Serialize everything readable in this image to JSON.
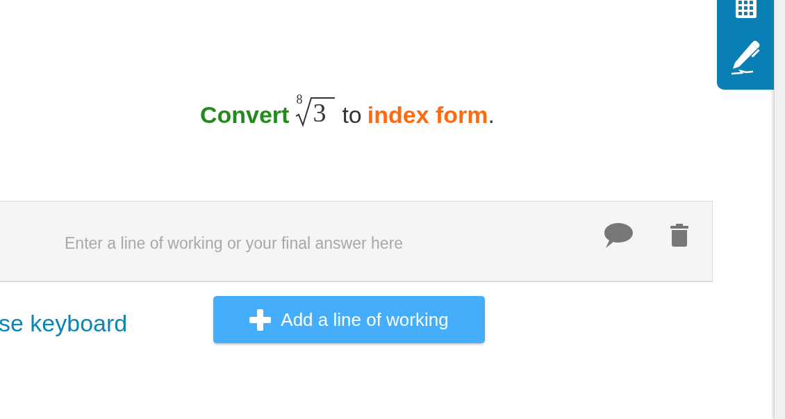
{
  "tools": {
    "items": [
      {
        "kind": "calculator"
      },
      {
        "kind": "pen"
      }
    ]
  },
  "question": {
    "parts": [
      {
        "kind": "emphasis",
        "text": "Convert",
        "color": "#238a1e"
      },
      {
        "kind": "root",
        "index": "8",
        "radicand": "3"
      },
      {
        "kind": "plain",
        "text": "to"
      },
      {
        "kind": "emphasis",
        "text": "index form",
        "color": "#ff6a10"
      },
      {
        "kind": "punct",
        "text": "."
      }
    ]
  },
  "answer": {
    "placeholder": "Enter a line of working or your final answer here"
  },
  "keyboard_link": "se keyboard",
  "add_button": "Add a line of working"
}
